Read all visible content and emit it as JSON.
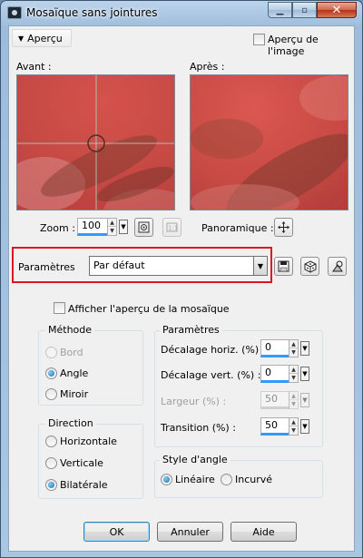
{
  "window": {
    "title": "Mosaïque sans jointures",
    "minimize_glyph": "▁",
    "maximize_glyph": "▫",
    "close_glyph": "✕"
  },
  "preview_toggle": {
    "label": "Aperçu",
    "glyph": "▼"
  },
  "image_preview_checkbox": {
    "label": "Aperçu de l'image",
    "checked": false
  },
  "before_label": "Avant :",
  "after_label": "Après :",
  "zoom": {
    "label": "Zoom :",
    "value": "100"
  },
  "pan": {
    "label": "Panoramique :"
  },
  "presets": {
    "label": "Paramètres",
    "value": "Par défaut"
  },
  "tile_preview_checkbox": {
    "label": "Afficher l'aperçu de la mosaïque",
    "checked": false
  },
  "method_group": {
    "title": "Méthode",
    "options": [
      {
        "label": "Bord",
        "checked": false,
        "enabled": false
      },
      {
        "label": "Angle",
        "checked": true,
        "enabled": true
      },
      {
        "label": "Miroir",
        "checked": false,
        "enabled": true
      }
    ]
  },
  "direction_group": {
    "title": "Direction",
    "options": [
      {
        "label": "Horizontale",
        "checked": false
      },
      {
        "label": "Verticale",
        "checked": false
      },
      {
        "label": "Bilatérale",
        "checked": true
      }
    ]
  },
  "params_group": {
    "title": "Paramètres",
    "fields": [
      {
        "label": "Décalage horiz. (%) :",
        "value": "0",
        "enabled": true
      },
      {
        "label": "Décalage vert. (%) :",
        "value": "0",
        "enabled": true
      },
      {
        "label": "Largeur (%) :",
        "value": "50",
        "enabled": false
      },
      {
        "label": "Transition (%) :",
        "value": "50",
        "enabled": true
      }
    ]
  },
  "corner_group": {
    "title": "Style d'angle",
    "options": [
      {
        "label": "Linéaire",
        "checked": true
      },
      {
        "label": "Incurvé",
        "checked": false
      }
    ]
  },
  "buttons": {
    "ok": "OK",
    "cancel": "Annuler",
    "help": "Aide"
  },
  "colors": {
    "highlight_box": "#e0141e",
    "accent": "#3399ff"
  }
}
